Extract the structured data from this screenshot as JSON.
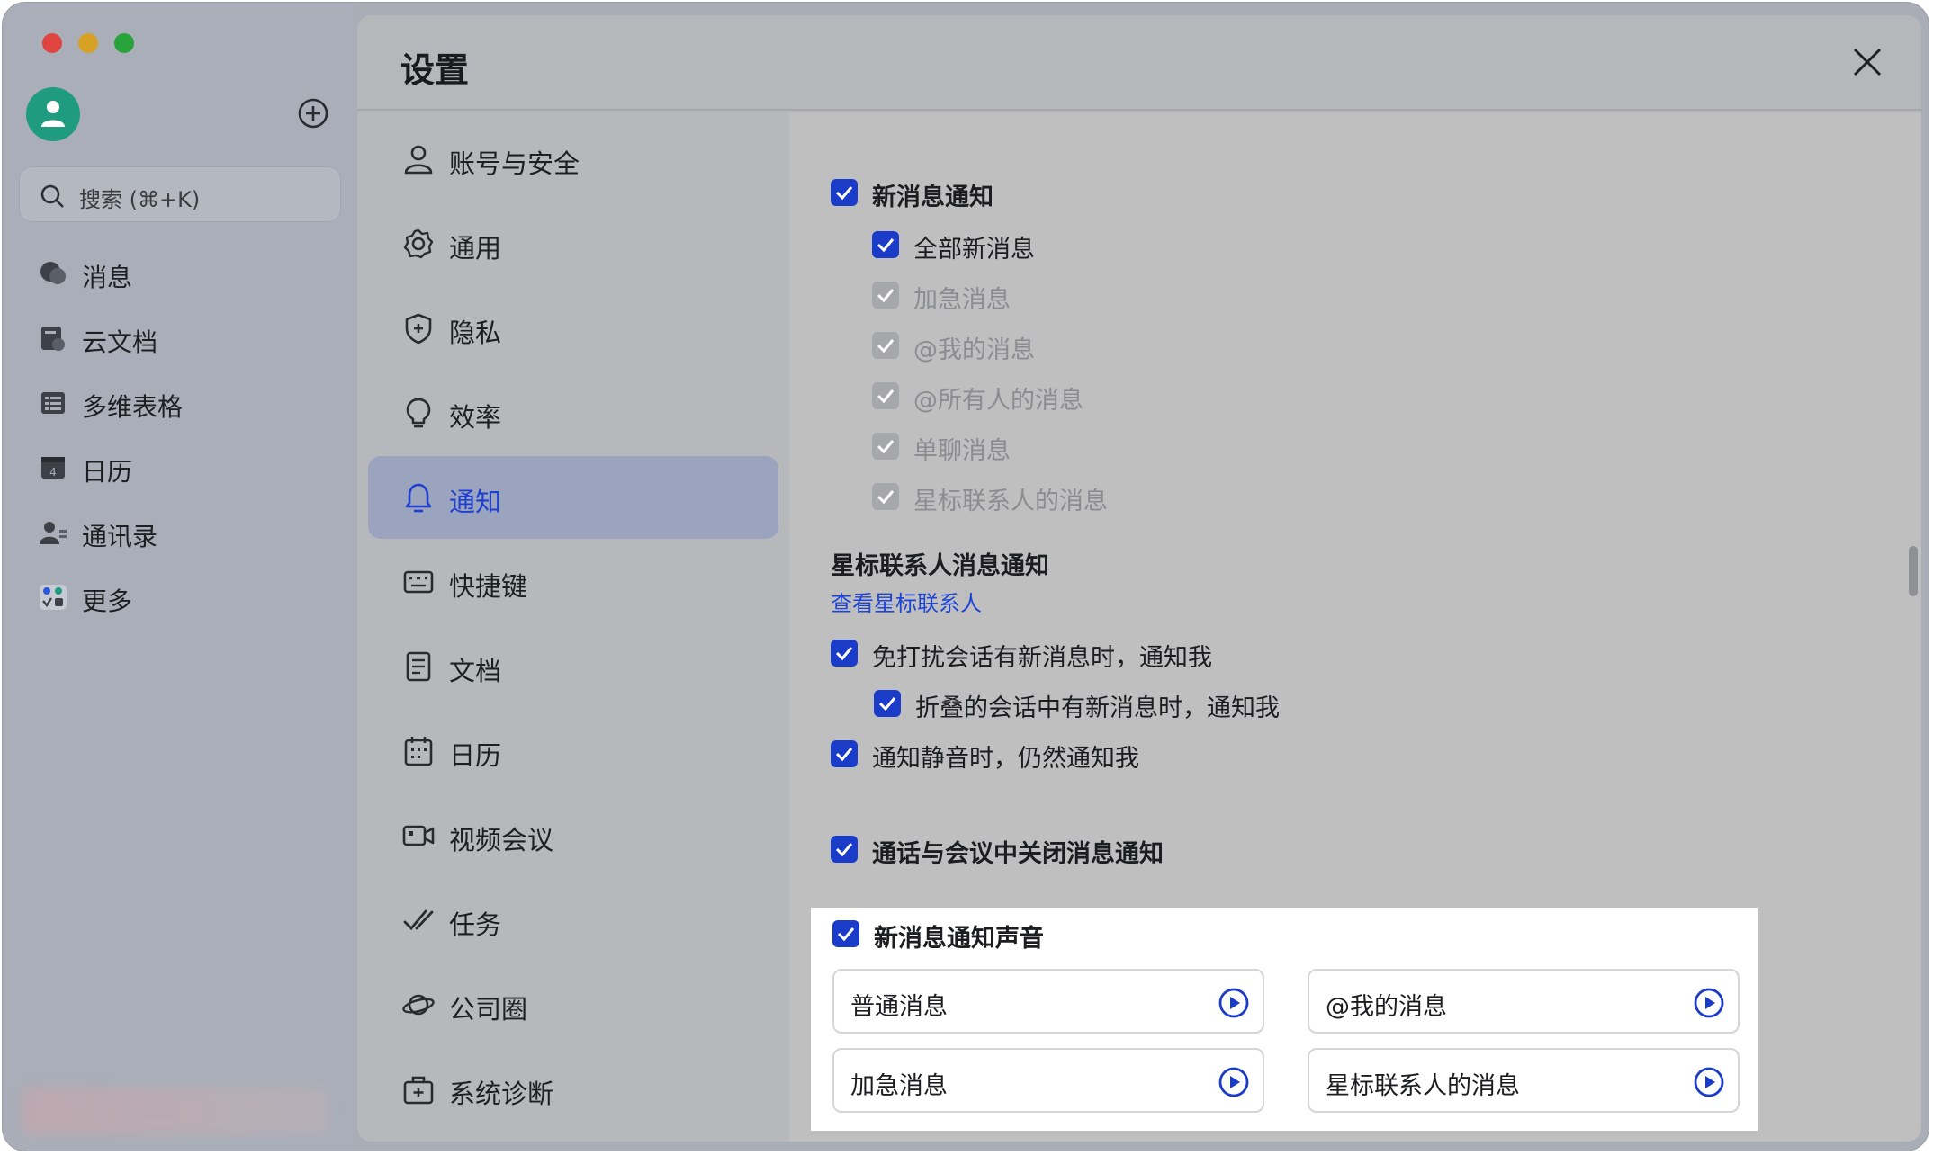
{
  "search": {
    "placeholder": "搜索 (⌘+K)"
  },
  "sidebar": {
    "items": [
      {
        "label": "消息",
        "icon": "chat-bubble-icon"
      },
      {
        "label": "云文档",
        "icon": "cloud-doc-icon"
      },
      {
        "label": "多维表格",
        "icon": "table-icon"
      },
      {
        "label": "日历",
        "icon": "calendar-icon"
      },
      {
        "label": "通讯录",
        "icon": "contacts-icon"
      },
      {
        "label": "更多",
        "icon": "apps-grid-icon"
      }
    ]
  },
  "settings": {
    "title": "设置",
    "nav": [
      {
        "label": "账号与安全",
        "icon": "user-icon"
      },
      {
        "label": "通用",
        "icon": "gear-icon"
      },
      {
        "label": "隐私",
        "icon": "shield-icon"
      },
      {
        "label": "效率",
        "icon": "lightbulb-icon"
      },
      {
        "label": "通知",
        "icon": "bell-icon",
        "active": true
      },
      {
        "label": "快捷键",
        "icon": "keyboard-icon"
      },
      {
        "label": "文档",
        "icon": "document-icon"
      },
      {
        "label": "日历",
        "icon": "calendar-icon"
      },
      {
        "label": "视频会议",
        "icon": "video-icon"
      },
      {
        "label": "任务",
        "icon": "task-check-icon"
      },
      {
        "label": "公司圈",
        "icon": "planet-icon"
      },
      {
        "label": "系统诊断",
        "icon": "medkit-icon"
      }
    ]
  },
  "notifications": {
    "new_message": {
      "label": "新消息通知",
      "checked": true
    },
    "all_new": {
      "label": "全部新消息",
      "checked": true
    },
    "disabled_options": [
      {
        "label": "加急消息",
        "checked": true
      },
      {
        "label": "@我的消息",
        "checked": true
      },
      {
        "label": "@所有人的消息",
        "checked": true
      },
      {
        "label": "单聊消息",
        "checked": true
      },
      {
        "label": "星标联系人的消息",
        "checked": true
      }
    ],
    "star_section": {
      "title": "星标联系人消息通知",
      "link": "查看星标联系人"
    },
    "dnd": {
      "label": "免打扰会话有新消息时，通知我",
      "checked": true
    },
    "folded": {
      "label": "折叠的会话中有新消息时，通知我",
      "checked": true
    },
    "muted": {
      "label": "通知静音时，仍然通知我",
      "checked": true
    },
    "call_meeting": {
      "label": "通话与会议中关闭消息通知",
      "checked": true
    },
    "sound": {
      "label": "新消息通知声音",
      "checked": true,
      "items": [
        "普通消息",
        "@我的消息",
        "加急消息",
        "星标联系人的消息"
      ]
    }
  },
  "colors": {
    "accent": "#1a3cc8",
    "link": "#1f45d6",
    "active_nav_bg": "#9aa4bf"
  }
}
